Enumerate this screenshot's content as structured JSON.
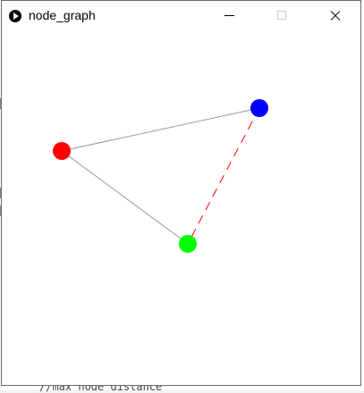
{
  "window": {
    "title": "node_graph",
    "controls": [
      "minimize",
      "maximize",
      "close"
    ]
  },
  "background_editor": {
    "bottom_code_fragment": "//max node distance"
  },
  "graph": {
    "nodes": [
      {
        "id": "red",
        "color": "#ff0000"
      },
      {
        "id": "blue",
        "color": "#0000ff"
      },
      {
        "id": "green",
        "color": "#00ff00"
      }
    ],
    "edges": [
      {
        "from": "red",
        "to": "blue",
        "style": "solid",
        "color": "#999999"
      },
      {
        "from": "red",
        "to": "green",
        "style": "solid",
        "color": "#999999"
      },
      {
        "from": "blue",
        "to": "green",
        "style": "dashed",
        "color": "#ff0000"
      }
    ]
  }
}
